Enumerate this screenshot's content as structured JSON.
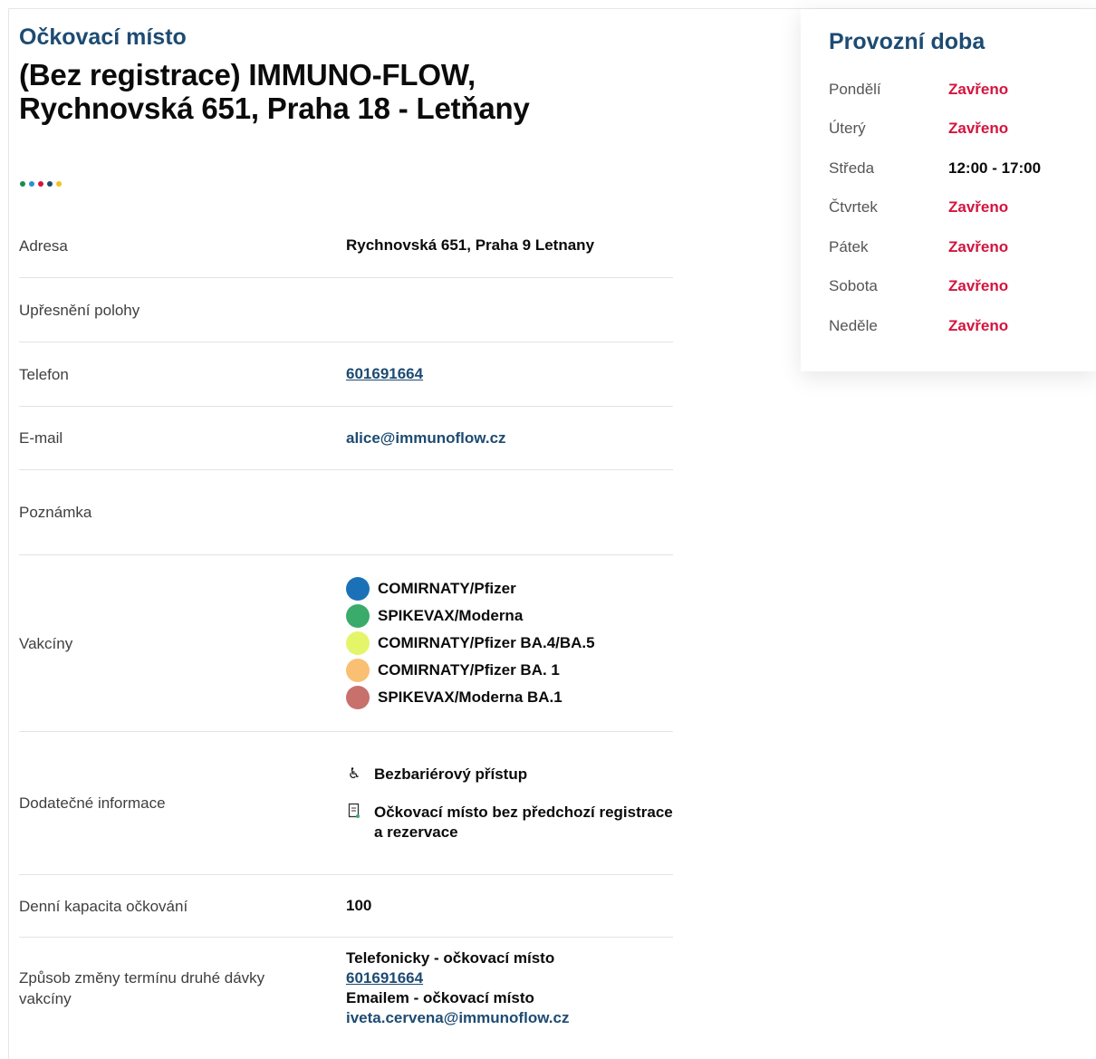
{
  "place": {
    "kicker": "Očkovací místo",
    "title_line1": "(Bez registrace) IMMUNO-FLOW,",
    "title_line2": "Rychnovská 651, Praha 18 - Letňany"
  },
  "decor_dots": [
    "#1f8a4c",
    "#2a8fd8",
    "#d3143f",
    "#1d4b72",
    "#f2c21b"
  ],
  "details": {
    "address_label": "Adresa",
    "address_value": "Rychnovská 651, Praha 9 Letnany",
    "location_label": "Upřesnění polohy",
    "location_value": "",
    "phone_label": "Telefon",
    "phone_value": "601691664",
    "email_label": "E-mail",
    "email_value": "alice@immunoflow.cz",
    "note_label": "Poznámka",
    "note_value": "",
    "vaccines_label": "Vakcíny",
    "vaccines": [
      {
        "name": "COMIRNATY/Pfizer",
        "color": "#1b71b8"
      },
      {
        "name": "SPIKEVAX/Moderna",
        "color": "#3aab6a"
      },
      {
        "name": "COMIRNATY/Pfizer BA.4/BA.5",
        "color": "#e5f56a"
      },
      {
        "name": "COMIRNATY/Pfizer BA. 1",
        "color": "#f9bf72"
      },
      {
        "name": "SPIKEVAX/Moderna BA.1",
        "color": "#c7706c"
      }
    ],
    "extra_label": "Dodatečné informace",
    "extra_items": [
      {
        "icon": "wheelchair-icon",
        "text": "Bezbariérový přístup"
      },
      {
        "icon": "document-icon",
        "text": "Očkovací místo bez předchozí registrace a rezervace"
      }
    ],
    "capacity_label": "Denní kapacita očkování",
    "capacity_value": "100",
    "change_label": "Způsob změny termínu druhé dávky vakcíny",
    "change_phone_title": "Telefonicky - očkovací místo",
    "change_phone_value": "601691664",
    "change_email_title": "Emailem - očkovací místo",
    "change_email_value": "iveta.cervena@immunoflow.cz"
  },
  "hours": {
    "title": "Provozní doba",
    "days": [
      {
        "day": "Pondělí",
        "time": "Zavřeno",
        "closed": true
      },
      {
        "day": "Úterý",
        "time": "Zavřeno",
        "closed": true
      },
      {
        "day": "Středa",
        "time": "12:00 - 17:00",
        "closed": false
      },
      {
        "day": "Čtvrtek",
        "time": "Zavřeno",
        "closed": true
      },
      {
        "day": "Pátek",
        "time": "Zavřeno",
        "closed": true
      },
      {
        "day": "Sobota",
        "time": "Zavřeno",
        "closed": true
      },
      {
        "day": "Neděle",
        "time": "Zavřeno",
        "closed": true
      }
    ]
  },
  "colors": {
    "accent": "#1d4b72",
    "closed": "#d3143f"
  }
}
